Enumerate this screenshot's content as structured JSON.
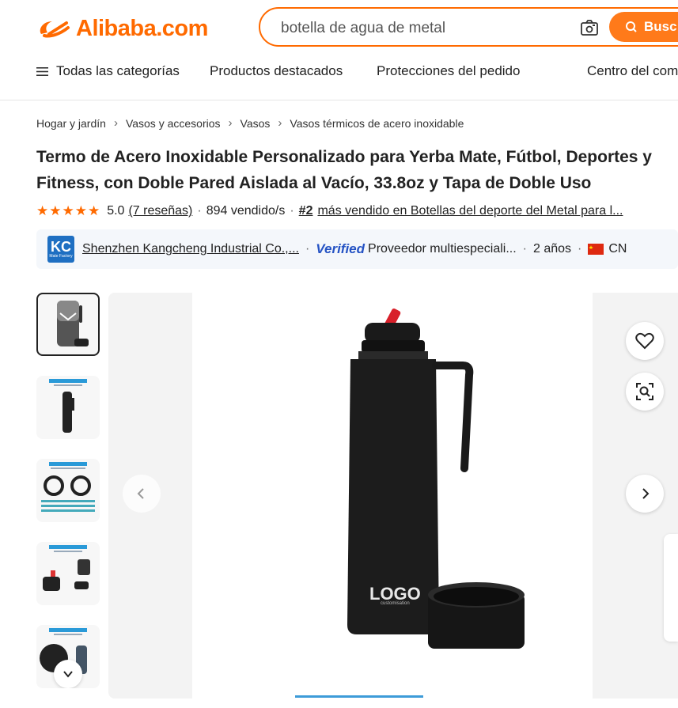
{
  "header": {
    "logo_text": "Alibaba.com",
    "search_placeholder": "botella de agua de metal",
    "search_button": "Busc",
    "brand_color": "#ff6a00"
  },
  "nav": {
    "all_categories": "Todas las categorías",
    "items": [
      "Productos destacados",
      "Protecciones del pedido",
      "Centro del com"
    ]
  },
  "breadcrumb": [
    "Hogar y jardín",
    "Vasos y accesorios",
    "Vasos",
    "Vasos térmicos de acero inoxidable"
  ],
  "product": {
    "title": "Termo de Acero Inoxidable Personalizado para Yerba Mate, Fútbol, Deportes y Fitness, con Doble Pared Aislada al Vacío, 33.8oz y Tapa de Doble Uso",
    "rating": "5.0",
    "reviews": "(7 reseñas)",
    "sold": "894 vendido/s",
    "rank_number": "#2",
    "rank_text": "más vendido en Botellas del deporte del Metal para l..."
  },
  "supplier": {
    "logo_text": "KC",
    "logo_subtext": "Mate Factory",
    "name": "Shenzhen Kangcheng Industrial Co.,...",
    "verified_label": "Verified",
    "type": "Proveedor multiespeciali...",
    "years": "2 años",
    "country": "CN"
  },
  "gallery": {
    "thumbnail_count": 5,
    "active_index": 0,
    "main_image_logo_text": "LOGO",
    "main_image_subtext": "customisation"
  },
  "icons": [
    "camera-icon",
    "search-icon",
    "menu-icon",
    "chevron-right-icon",
    "star-icon",
    "verified-icon",
    "cn-flag-icon",
    "heart-icon",
    "image-search-icon",
    "chevron-left-icon",
    "chevron-down-icon"
  ]
}
